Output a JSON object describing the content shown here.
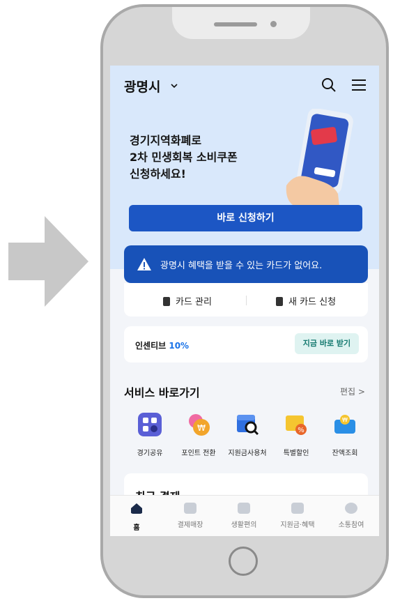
{
  "header": {
    "city": "광명시"
  },
  "hero": {
    "lines": [
      "경기지역화폐로",
      "2차 민생회복 소비쿠폰",
      "신청하세요!"
    ],
    "apply_button": "바로 신청하기"
  },
  "alert": {
    "message": "광명시 혜택을 받을 수 있는 카드가 없어요."
  },
  "card_actions": {
    "manage": "카드 관리",
    "new_card": "새 카드 신청"
  },
  "incentive": {
    "label": "인센티브",
    "value": "10%",
    "button": "지금 바로 받기"
  },
  "services": {
    "title": "서비스 바로가기",
    "edit": "편집 >",
    "items": [
      {
        "label": "경기공유",
        "icon": "share-icon",
        "color": "#5a5fd6"
      },
      {
        "label": "포인트 전환",
        "icon": "point-convert-icon",
        "color": "#f2a52b"
      },
      {
        "label": "지원금사용처",
        "icon": "store-search-icon",
        "color": "#2f6fe0"
      },
      {
        "label": "특별할인",
        "icon": "discount-icon",
        "color": "#f5c530"
      },
      {
        "label": "잔액조회",
        "icon": "wallet-icon",
        "color": "#2a8fe6"
      }
    ]
  },
  "recent": {
    "title": "최근 결제"
  },
  "tabs": [
    {
      "label": "홈",
      "active": true
    },
    {
      "label": "결제매장"
    },
    {
      "label": "생활편의"
    },
    {
      "label": "지원금·혜택"
    },
    {
      "label": "소통참여"
    }
  ]
}
